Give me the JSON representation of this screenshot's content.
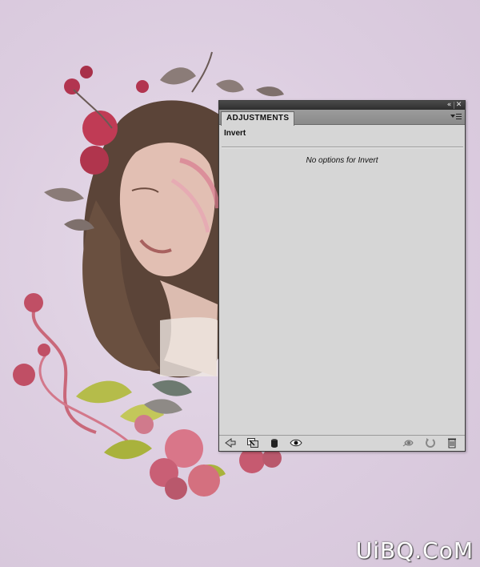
{
  "panel": {
    "tab_label": "ADJUSTMENTS",
    "adjustment_title": "Invert",
    "message": "No options for Invert",
    "titlebar": {
      "collapse_icon": "double-left-arrow-icon",
      "close_icon": "close-icon"
    },
    "footer_icons": [
      "back-arrow-icon",
      "clip-to-layer-icon",
      "visibility-mask-icon",
      "eye-icon",
      "view-previous-state-icon",
      "reset-icon",
      "trash-icon"
    ]
  },
  "watermark": "UiBQ.CoM",
  "colors": {
    "canvas_bg": "#dccde0",
    "panel_bg": "#d6d6d6",
    "titlebar": "#3a3a3a",
    "tabbar": "#939393"
  }
}
